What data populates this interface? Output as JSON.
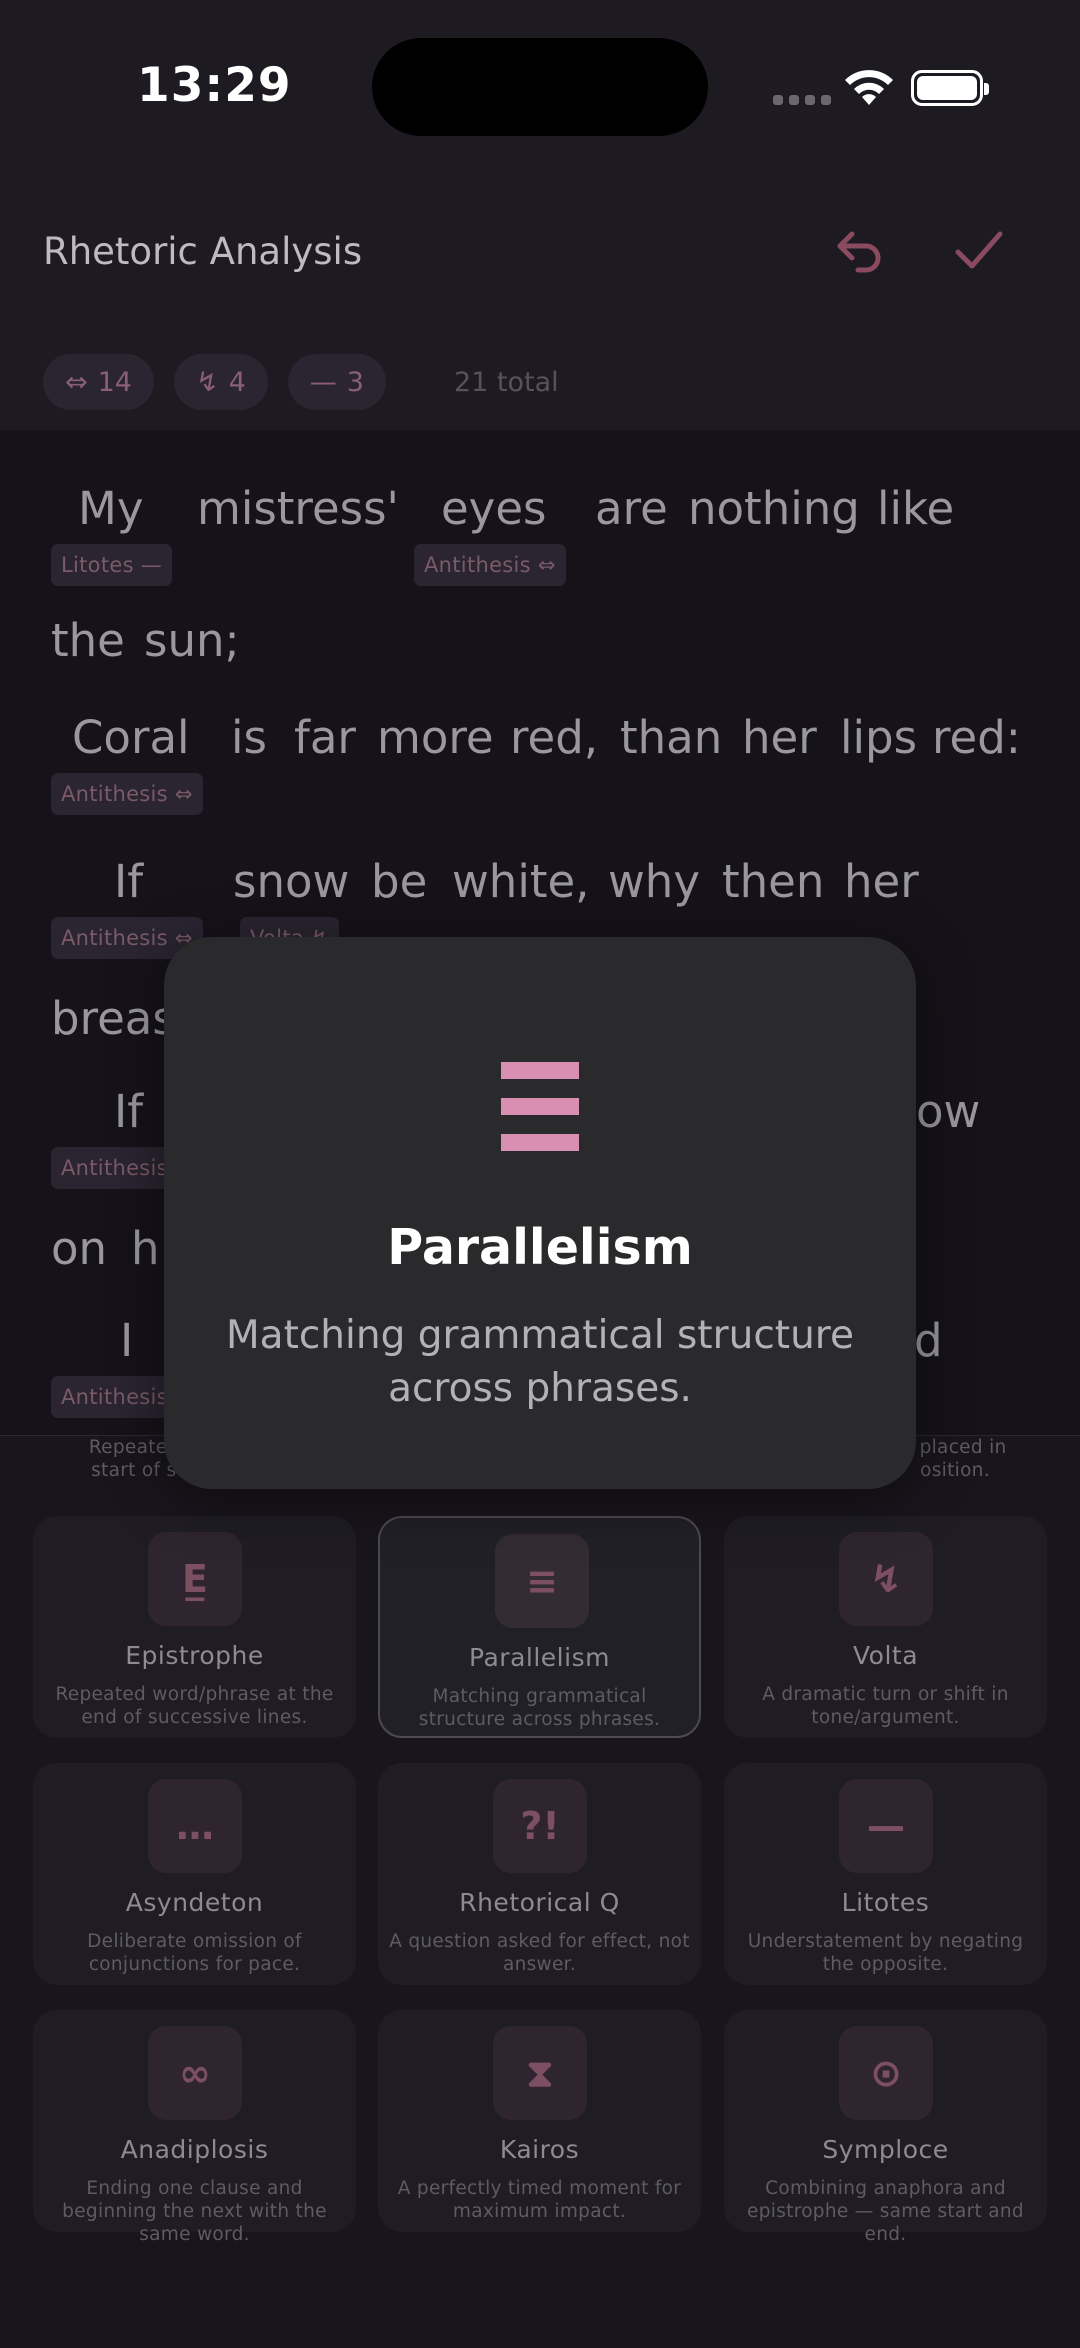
{
  "status": {
    "time": "13:29"
  },
  "header": {
    "title": "Rhetoric Analysis",
    "undo_icon": "undo-arrow-icon",
    "done_icon": "checkmark-icon"
  },
  "chips": {
    "antithesis": {
      "glyph": "⇔",
      "count": "14"
    },
    "volta": {
      "glyph": "↯",
      "count": "4"
    },
    "litotes": {
      "glyph": "—",
      "count": "3"
    },
    "total": "21 total"
  },
  "poem": {
    "l1": [
      "My",
      "mistress'",
      "eyes",
      "are",
      "nothing",
      "like"
    ],
    "l2": [
      "the",
      "sun;"
    ],
    "l3": [
      "Coral",
      "is",
      "far",
      "more",
      "red,",
      "than",
      "her",
      "lips",
      "red:"
    ],
    "l4": [
      "If",
      "snow",
      "be",
      "white,",
      "why",
      "then",
      "her"
    ],
    "l5": [
      "breas"
    ],
    "l6": [
      "If",
      "ow"
    ],
    "l7": [
      "on",
      "h"
    ],
    "l8": [
      "I",
      "d"
    ],
    "tags": {
      "litotes": "Litotes —",
      "antithesis": "Antithesis ⇔",
      "volta": "Volta ↯",
      "antithesis_cut": "Antithesis"
    }
  },
  "devices": [
    {
      "name": "Epistrophe",
      "glyph": "E̲",
      "desc": "Repeated word/phrase at the end of successive lines."
    },
    {
      "name": "Parallelism",
      "glyph": "≡",
      "desc": "Matching grammatical structure across phrases."
    },
    {
      "name": "Volta",
      "glyph": "↯",
      "desc": "A dramatic turn or shift in tone/argument."
    },
    {
      "name": "Asyndeton",
      "glyph": "…",
      "desc": "Deliberate omission of conjunctions for pace."
    },
    {
      "name": "Rhetorical Q",
      "glyph": "?!",
      "desc": "A question asked for effect, not answer."
    },
    {
      "name": "Litotes",
      "glyph": "—",
      "desc": "Understatement by negating the opposite."
    },
    {
      "name": "Anadiplosis",
      "glyph": "∞",
      "desc": "Ending one clause and beginning the next with the same word."
    },
    {
      "name": "Kairos",
      "glyph": "⧗",
      "desc": "A perfectly timed moment for maximum impact."
    },
    {
      "name": "Symploce",
      "glyph": "⊙",
      "desc": "Combining anaphora and epistrophe — same start and end."
    }
  ],
  "partial_row": {
    "left_l1": "Repeated w",
    "left_l2": "start of suc",
    "right_l1": "s placed in",
    "right_l2": "osition."
  },
  "overlay": {
    "icon": "parallelism-icon",
    "title": "Parallelism",
    "desc": "Matching grammatical structure across phrases."
  },
  "colors": {
    "accent": "#d98fb1",
    "muted_accent": "#7d4f63",
    "background": "#151219"
  }
}
